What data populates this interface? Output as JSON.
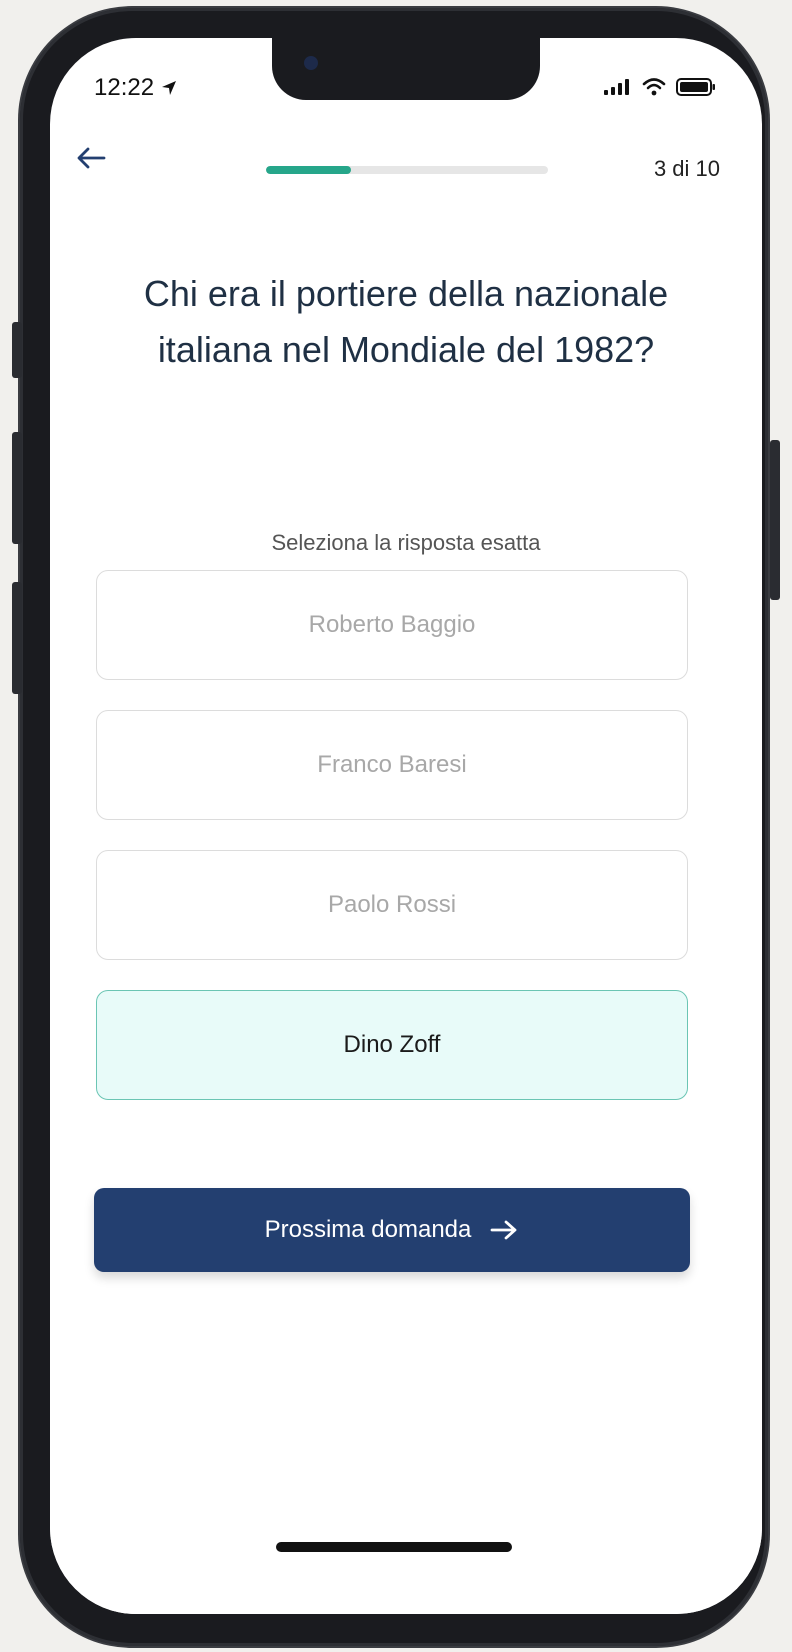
{
  "status_bar": {
    "time": "12:22"
  },
  "header": {
    "counter": "3 di 10",
    "progress_fraction": 0.3
  },
  "quiz": {
    "question": "Chi era il portiere della nazionale italiana nel Mondiale del 1982?",
    "instruction": "Seleziona la risposta esatta",
    "options": [
      {
        "label": "Roberto Baggio",
        "selected": false
      },
      {
        "label": "Franco Baresi",
        "selected": false
      },
      {
        "label": "Paolo Rossi",
        "selected": false
      },
      {
        "label": "Dino Zoff",
        "selected": true
      }
    ],
    "next_label": "Prossima domanda"
  },
  "colors": {
    "accent_progress": "#26a68a",
    "primary_button": "#233f70",
    "selected_background": "#e8fbf9",
    "selected_border": "#6bc5b4",
    "question_text": "#1f3044"
  },
  "icons": {
    "back": "arrow-left-icon",
    "next": "arrow-right-icon",
    "location": "location-arrow-icon",
    "signal": "signal-icon",
    "wifi": "wifi-icon",
    "battery": "battery-icon"
  }
}
